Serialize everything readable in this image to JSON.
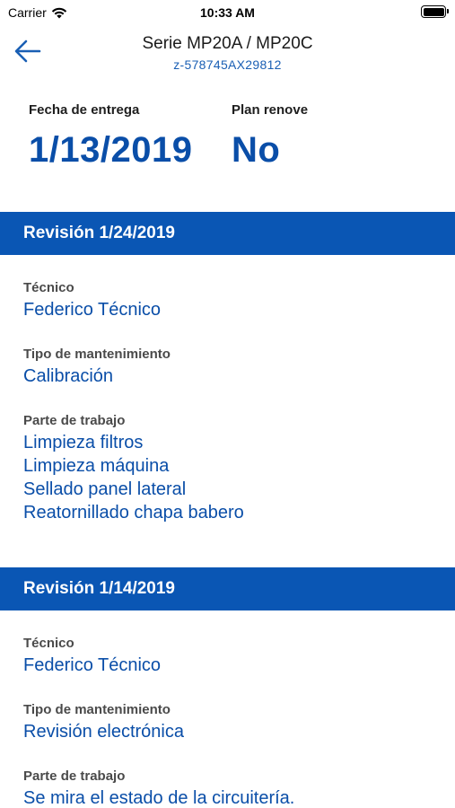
{
  "status_bar": {
    "carrier": "Carrier",
    "time": "10:33 AM"
  },
  "nav": {
    "title": "Serie MP20A / MP20C",
    "subtitle": "z-578745AX29812"
  },
  "summary": {
    "delivery_label": "Fecha de entrega",
    "delivery_value": "1/13/2019",
    "renove_label": "Plan renove",
    "renove_value": "No"
  },
  "revisions": [
    {
      "header": "Revisión 1/24/2019",
      "tech_label": "Técnico",
      "tech_value": "Federico Técnico",
      "type_label": "Tipo de mantenimiento",
      "type_value": "Calibración",
      "work_label": "Parte de trabajo",
      "work_items": [
        "Limpieza filtros",
        "Limpieza máquina",
        "Sellado panel lateral",
        "Reatornillado chapa babero"
      ]
    },
    {
      "header": "Revisión 1/14/2019",
      "tech_label": "Técnico",
      "tech_value": "Federico Técnico",
      "type_label": "Tipo de mantenimiento",
      "type_value": "Revisión electrónica",
      "work_label": "Parte de trabajo",
      "work_items": [
        "Se mira el estado de la circuitería."
      ]
    }
  ],
  "colors": {
    "accent": "#0a56b4",
    "link_text": "#0a4ea8"
  }
}
